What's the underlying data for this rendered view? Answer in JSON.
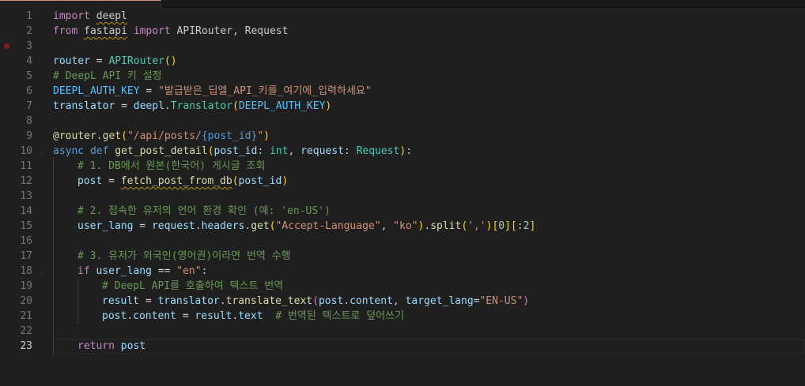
{
  "editor": {
    "current_line": 23,
    "breakpoint_line": 3,
    "lines": [
      {
        "n": 1,
        "indent": 0,
        "tokens": [
          [
            "kw",
            "import"
          ],
          [
            "",
            " "
          ],
          [
            "sq",
            "deepl"
          ]
        ]
      },
      {
        "n": 2,
        "indent": 0,
        "tokens": [
          [
            "kw",
            "from"
          ],
          [
            "",
            " "
          ],
          [
            "sq",
            "fastapi"
          ],
          [
            "",
            " "
          ],
          [
            "kw",
            "import"
          ],
          [
            "",
            " APIRouter, Request"
          ]
        ]
      },
      {
        "n": 3,
        "indent": 0,
        "tokens": []
      },
      {
        "n": 4,
        "indent": 0,
        "tokens": [
          [
            "var",
            "router"
          ],
          [
            "op",
            " = "
          ],
          [
            "cls",
            "APIRouter"
          ],
          [
            "brk",
            "()"
          ]
        ]
      },
      {
        "n": 5,
        "indent": 0,
        "tokens": [
          [
            "cmt",
            "# DeepL API 키 설정"
          ]
        ]
      },
      {
        "n": 6,
        "indent": 0,
        "tokens": [
          [
            "cst",
            "DEEPL_AUTH_KEY"
          ],
          [
            "op",
            " = "
          ],
          [
            "str",
            "\"발급받은_딥엘_API_키를_여기에_입력하세요\""
          ]
        ]
      },
      {
        "n": 7,
        "indent": 0,
        "tokens": [
          [
            "var",
            "translator"
          ],
          [
            "op",
            " = "
          ],
          [
            "var",
            "deepl"
          ],
          [
            "",
            "."
          ],
          [
            "cls",
            "Translator"
          ],
          [
            "brk",
            "("
          ],
          [
            "cst",
            "DEEPL_AUTH_KEY"
          ],
          [
            "brk",
            ")"
          ]
        ]
      },
      {
        "n": 8,
        "indent": 0,
        "tokens": []
      },
      {
        "n": 9,
        "indent": 0,
        "tokens": [
          [
            "fn",
            "@router"
          ],
          [
            "",
            "."
          ],
          [
            "fn",
            "get"
          ],
          [
            "brk",
            "("
          ],
          [
            "str",
            "\"/api/posts/"
          ],
          [
            "kw2",
            "{post_id}"
          ],
          [
            "str",
            "\""
          ],
          [
            "brk",
            ")"
          ]
        ]
      },
      {
        "n": 10,
        "indent": 0,
        "fold": true,
        "tokens": [
          [
            "kw2",
            "async"
          ],
          [
            "",
            " "
          ],
          [
            "kw2",
            "def"
          ],
          [
            "",
            " "
          ],
          [
            "fn",
            "get_post_detail"
          ],
          [
            "brk",
            "("
          ],
          [
            "var",
            "post_id"
          ],
          [
            "",
            ": "
          ],
          [
            "cls",
            "int"
          ],
          [
            "",
            ", "
          ],
          [
            "var",
            "request"
          ],
          [
            "",
            ": "
          ],
          [
            "cls",
            "Request"
          ],
          [
            "brk",
            ")"
          ],
          [
            "",
            ":"
          ]
        ]
      },
      {
        "n": 11,
        "indent": 1,
        "tokens": [
          [
            "cmt",
            "# 1. DB에서 원본(한국어) 게시글 조회"
          ]
        ]
      },
      {
        "n": 12,
        "indent": 1,
        "tokens": [
          [
            "var",
            "post"
          ],
          [
            "op",
            " = "
          ],
          [
            "fn sq",
            "fetch_post_from_db"
          ],
          [
            "brk",
            "("
          ],
          [
            "var",
            "post_id"
          ],
          [
            "brk",
            ")"
          ]
        ]
      },
      {
        "n": 13,
        "indent": 1,
        "tokens": []
      },
      {
        "n": 14,
        "indent": 1,
        "tokens": [
          [
            "cmt",
            "# 2. 접속한 유저의 언어 환경 확인 (예: 'en-US')"
          ]
        ]
      },
      {
        "n": 15,
        "indent": 1,
        "tokens": [
          [
            "var",
            "user_lang"
          ],
          [
            "op",
            " = "
          ],
          [
            "var",
            "request"
          ],
          [
            "",
            "."
          ],
          [
            "var",
            "headers"
          ],
          [
            "",
            "."
          ],
          [
            "fn",
            "get"
          ],
          [
            "brk",
            "("
          ],
          [
            "str",
            "\"Accept-Language\""
          ],
          [
            "",
            ", "
          ],
          [
            "str",
            "\"ko\""
          ],
          [
            "brk",
            ")"
          ],
          [
            "",
            "."
          ],
          [
            "fn",
            "split"
          ],
          [
            "brk",
            "("
          ],
          [
            "str",
            "','"
          ],
          [
            "brk",
            ")"
          ],
          [
            "brk",
            "["
          ],
          [
            "num",
            "0"
          ],
          [
            "brk",
            "]"
          ],
          [
            "brk",
            "["
          ],
          [
            "",
            ":"
          ],
          [
            "num",
            "2"
          ],
          [
            "brk",
            "]"
          ]
        ]
      },
      {
        "n": 16,
        "indent": 1,
        "tokens": []
      },
      {
        "n": 17,
        "indent": 1,
        "tokens": [
          [
            "cmt",
            "# 3. 유저가 외국인(영어권)이라면 번역 수행"
          ]
        ]
      },
      {
        "n": 18,
        "indent": 1,
        "fold": true,
        "tokens": [
          [
            "kw",
            "if"
          ],
          [
            "",
            " "
          ],
          [
            "var",
            "user_lang"
          ],
          [
            "op",
            " == "
          ],
          [
            "str",
            "\"en\""
          ],
          [
            "",
            ":"
          ]
        ]
      },
      {
        "n": 19,
        "indent": 2,
        "tokens": [
          [
            "cmt",
            "# DeepL API를 호출하여 텍스트 번역"
          ]
        ]
      },
      {
        "n": 20,
        "indent": 2,
        "tokens": [
          [
            "var",
            "result"
          ],
          [
            "op",
            " = "
          ],
          [
            "var",
            "translator"
          ],
          [
            "",
            "."
          ],
          [
            "fn",
            "translate_text"
          ],
          [
            "brk2",
            "("
          ],
          [
            "var",
            "post"
          ],
          [
            "",
            "."
          ],
          [
            "var",
            "content"
          ],
          [
            "",
            ", "
          ],
          [
            "var",
            "target_lang"
          ],
          [
            "op",
            "="
          ],
          [
            "str",
            "\"EN-US\""
          ],
          [
            "brk2",
            ")"
          ]
        ]
      },
      {
        "n": 21,
        "indent": 2,
        "tokens": [
          [
            "var",
            "post"
          ],
          [
            "",
            "."
          ],
          [
            "var",
            "content"
          ],
          [
            "op",
            " = "
          ],
          [
            "var",
            "result"
          ],
          [
            "",
            "."
          ],
          [
            "var",
            "text"
          ],
          [
            "",
            "  "
          ],
          [
            "cmt",
            "# 번역된 텍스트로 덮어쓰기"
          ]
        ]
      },
      {
        "n": 22,
        "indent": 1,
        "tokens": []
      },
      {
        "n": 23,
        "indent": 1,
        "tokens": [
          [
            "kw",
            "return"
          ],
          [
            "",
            " "
          ],
          [
            "var",
            "post"
          ]
        ]
      }
    ]
  }
}
